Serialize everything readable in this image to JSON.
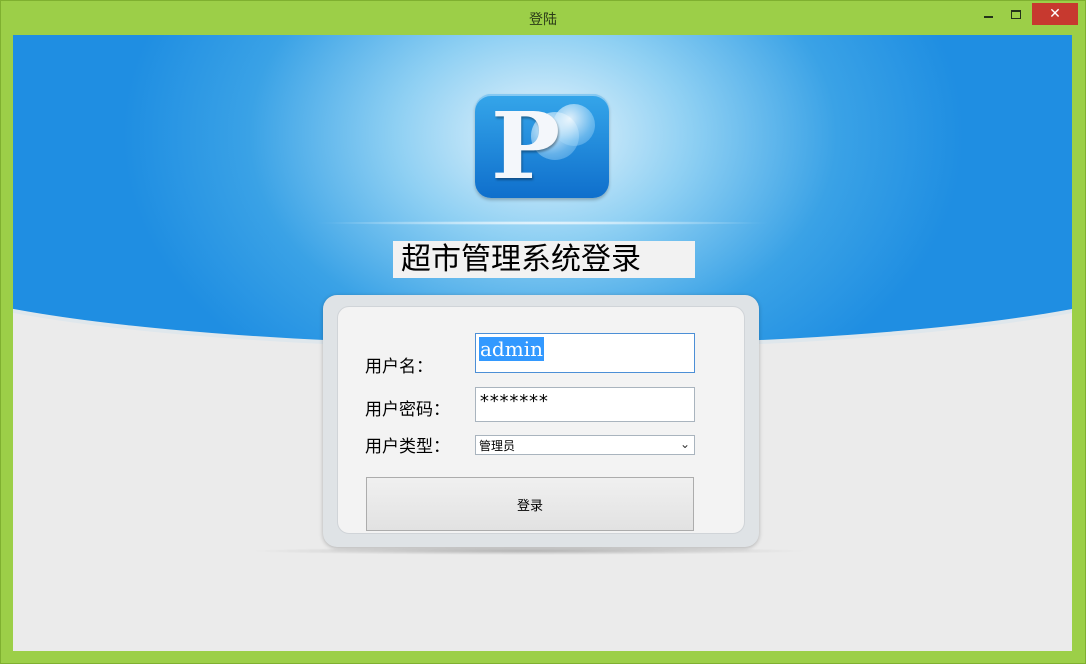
{
  "window": {
    "title": "登陆",
    "minimize_glyph": "",
    "maximize_glyph": "",
    "close_glyph": "✕"
  },
  "app": {
    "heading": "超市管理系统登录",
    "logo_letter": "P"
  },
  "form": {
    "username_label": "用户名：",
    "username_value": "admin",
    "password_label": "用户密码：",
    "password_value": "*******",
    "usertype_label": "用户类型：",
    "usertype_selected": "管理员",
    "login_button": "登录"
  },
  "colors": {
    "titlebar": "#9ccf48",
    "close_button": "#c7392f",
    "sky_blue": "#1f8ee2",
    "selection": "#3399ff"
  }
}
